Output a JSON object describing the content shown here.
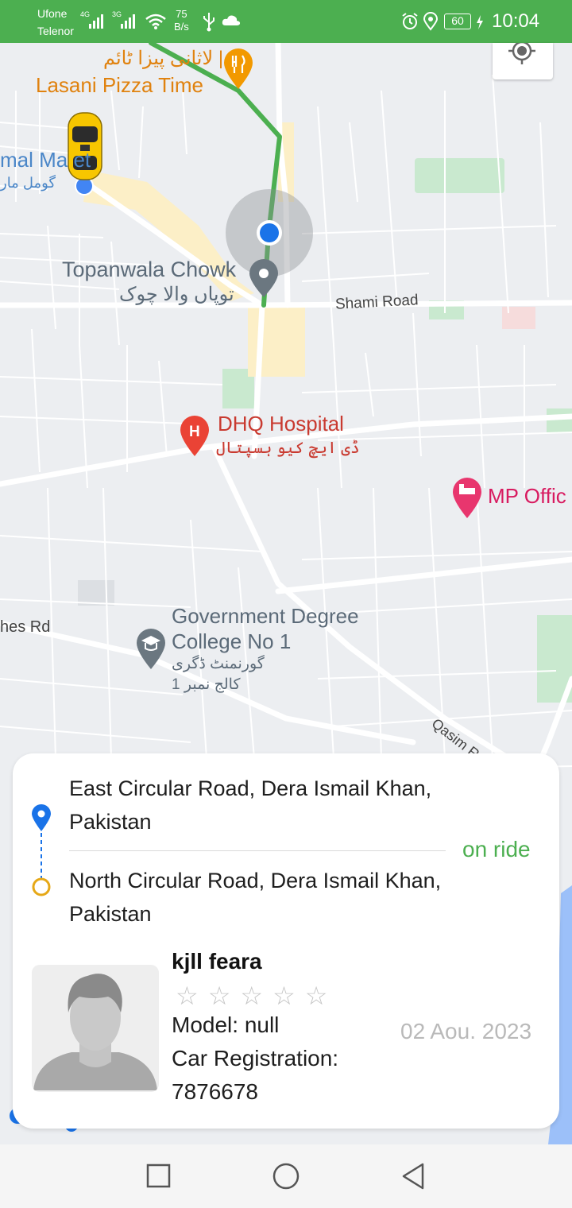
{
  "status_bar": {
    "carrier_1": "Ufone",
    "carrier_2": "Telenor",
    "signal_1_type": "4G",
    "signal_2_type": "3G",
    "net_speed_value": "75",
    "net_speed_unit": "B/s",
    "battery": "60",
    "time": "10:04",
    "icons": [
      "signal-icon",
      "wifi-icon",
      "usb-icon",
      "cloud-icon",
      "alarm-icon",
      "location-icon",
      "battery-icon",
      "charging-icon"
    ]
  },
  "map": {
    "labels": {
      "lasani_ur": "لاثانی پیزا ٹائم |",
      "lasani_en": "Lasani Pizza Time",
      "gomal_en": "mal Ma  et",
      "gomal_ur": "گومل مار",
      "topanwala_en": "Topanwala Chowk",
      "topanwala_ur": "توپاں والا چوک",
      "shami_road": "Shami Road",
      "dhq_en": "DHQ Hospital",
      "dhq_ur": "ڈی ایچ کیو ہسپتال",
      "mp_office": "MP Offic",
      "govt_college_line1": "Government Degree",
      "govt_college_line2": "College No 1",
      "govt_college_ur1": "گورنمنٹ ڈگری",
      "govt_college_ur2": "کالج نمبر 1",
      "hes_rd": "hes Rd",
      "qasim_road": "Qasim R"
    },
    "colors": {
      "route": "#4caf50",
      "location_dot": "#1a73e8",
      "food_pin": "#f29900",
      "hospital_pin": "#ea4335",
      "lodging_pin": "#e8366e",
      "gray_pin": "#6b7780",
      "park": "#c9e9cf"
    }
  },
  "trip_card": {
    "pickup_address": "East Circular Road, Dera Ismail Khan, Pakistan",
    "dropoff_address": "North Circular Road, Dera Ismail Khan, Pakistan",
    "status": "on ride",
    "driver_name": "kjll feara",
    "rating": 0,
    "rating_max": 5,
    "model_line": "Model: null",
    "registration_label": "Car Registration:",
    "registration_value": "7876678",
    "date": "02 Aou. 2023",
    "colors": {
      "pickup": "#1a73e8",
      "dropoff": "#e6a817",
      "status": "#4caf50"
    }
  },
  "nav_bar": {
    "buttons": [
      "recent-apps",
      "home",
      "back"
    ]
  }
}
